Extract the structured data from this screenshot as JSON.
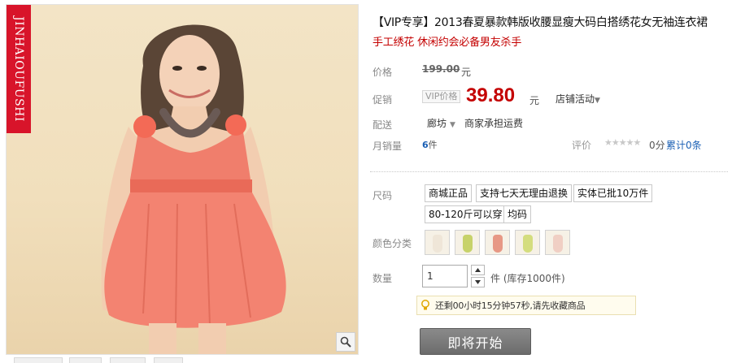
{
  "product": {
    "brand_vertical": "JINHAIOUFUSHI",
    "title": "【VIP专享】2013春夏暴款韩版收腰显瘦大码白搭绣花女无袖连衣裙",
    "subtitle": "手工绣花 休闲约会必备男友杀手"
  },
  "price": {
    "label": "价格",
    "original": "199.00",
    "currency": "元",
    "promo_label": "促销",
    "vip_tag": "VIP价格",
    "vip_value": "39.80",
    "promo_link": "店铺活动"
  },
  "shipping": {
    "label": "配送",
    "city": "廊坊",
    "note": "商家承担运费"
  },
  "sales": {
    "label": "月销量",
    "count": "6",
    "unit": "件",
    "rating_label": "评价",
    "stars": "★★★★★",
    "score": "0分",
    "reviews": "累计0条"
  },
  "size": {
    "label": "尺码",
    "options": [
      "商城正品",
      "支持七天无理由退换",
      "实体已批10万件",
      "80-120斤可以穿",
      "均码"
    ]
  },
  "color": {
    "label": "颜色分类",
    "swatch_colors": [
      "#efe6d8",
      "#c7d26a",
      "#e79885",
      "#d4dd7e",
      "#f0cfc4"
    ]
  },
  "quantity": {
    "label": "数量",
    "value": "1",
    "stock": "件 (库存1000件)"
  },
  "notice": {
    "text": "还剩00小时15分钟57秒,请先收藏商品"
  },
  "buy_button": "即将开始",
  "colors": {
    "accent_red": "#c40000",
    "brand_strip": "#d8142a"
  }
}
